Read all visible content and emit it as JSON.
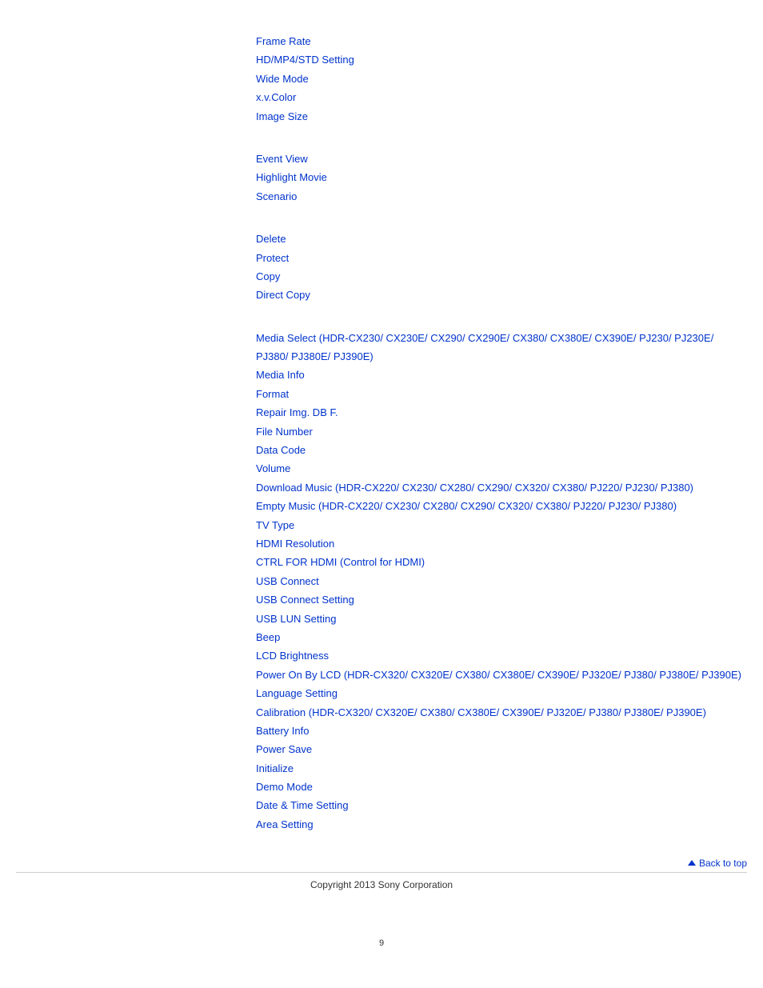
{
  "groups": [
    {
      "items": [
        {
          "label": "Frame Rate"
        },
        {
          "label": "HD/MP4/STD Setting"
        },
        {
          "label": "Wide Mode"
        },
        {
          "label": "x.v.Color"
        },
        {
          "label": "Image Size"
        }
      ]
    },
    {
      "items": [
        {
          "label": "Event View"
        },
        {
          "label": "Highlight Movie"
        },
        {
          "label": "Scenario"
        }
      ]
    },
    {
      "items": [
        {
          "label": "Delete"
        },
        {
          "label": "Protect"
        },
        {
          "label": "Copy"
        },
        {
          "label": "Direct Copy"
        }
      ]
    },
    {
      "items": [
        {
          "label": "Media Select (HDR-CX230/ CX230E/ CX290/ CX290E/ CX380/ CX380E/ CX390E/ PJ230/ PJ230E/ PJ380/ PJ380E/ PJ390E)"
        },
        {
          "label": "Media Info"
        },
        {
          "label": "Format"
        },
        {
          "label": "Repair Img. DB F."
        },
        {
          "label": "File Number"
        },
        {
          "label": "Data Code"
        },
        {
          "label": "Volume"
        },
        {
          "label": "Download Music (HDR-CX220/ CX230/ CX280/ CX290/ CX320/ CX380/ PJ220/ PJ230/ PJ380)"
        },
        {
          "label": "Empty Music (HDR-CX220/ CX230/ CX280/ CX290/ CX320/ CX380/ PJ220/ PJ230/ PJ380)"
        },
        {
          "label": "TV Type"
        },
        {
          "label": "HDMI Resolution"
        },
        {
          "label": "CTRL FOR HDMI (Control for HDMI)"
        },
        {
          "label": "USB Connect"
        },
        {
          "label": "USB Connect Setting"
        },
        {
          "label": "USB LUN Setting"
        },
        {
          "label": "Beep"
        },
        {
          "label": "LCD Brightness"
        },
        {
          "label": "Power On By LCD (HDR-CX320/ CX320E/ CX380/ CX380E/ CX390E/ PJ320E/ PJ380/ PJ380E/ PJ390E)"
        },
        {
          "label": "Language Setting"
        },
        {
          "label": "Calibration (HDR-CX320/ CX320E/ CX380/ CX380E/ CX390E/ PJ320E/ PJ380/ PJ380E/ PJ390E)"
        },
        {
          "label": "Battery Info"
        },
        {
          "label": "Power Save"
        },
        {
          "label": "Initialize"
        },
        {
          "label": "Demo Mode"
        },
        {
          "label": "Date & Time Setting"
        },
        {
          "label": "Area Setting"
        }
      ]
    }
  ],
  "back_to_top": "Back to top",
  "copyright": "Copyright 2013 Sony Corporation",
  "page_number": "9"
}
